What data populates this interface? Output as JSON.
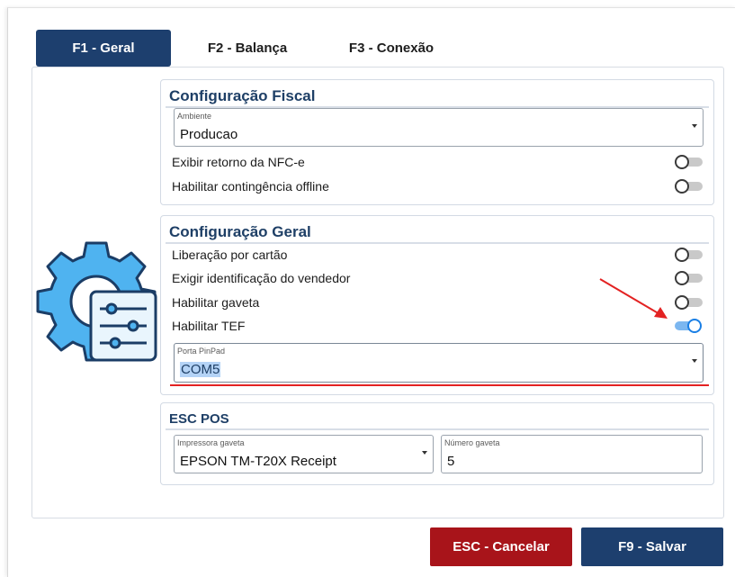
{
  "tabs": [
    {
      "label": "F1 - Geral",
      "active": true
    },
    {
      "label": "F2 - Balança",
      "active": false
    },
    {
      "label": "F3 - Conexão",
      "active": false
    }
  ],
  "fiscal": {
    "title": "Configuração Fiscal",
    "ambiente": {
      "label": "Ambiente",
      "value": "Producao"
    },
    "toggles": [
      {
        "label": "Exibir retorno da NFC-e",
        "on": false
      },
      {
        "label": "Habilitar contingência offline",
        "on": false
      }
    ]
  },
  "geral": {
    "title": "Configuração Geral",
    "toggles": [
      {
        "label": "Liberação por cartão",
        "on": false
      },
      {
        "label": "Exigir identificação do vendedor",
        "on": false
      },
      {
        "label": "Habilitar gaveta",
        "on": false
      },
      {
        "label": "Habilitar TEF",
        "on": true
      }
    ],
    "porta": {
      "label": "Porta PinPad",
      "value": "COM5"
    }
  },
  "escpos": {
    "title": "ESC POS",
    "impressora": {
      "label": "Impressora gaveta",
      "value": "EPSON TM-T20X Receipt"
    },
    "numero": {
      "label": "Número gaveta",
      "value": "5"
    }
  },
  "buttons": {
    "cancel": "ESC - Cancelar",
    "save": "F9 - Salvar"
  },
  "colors": {
    "primary": "#1d3f6e",
    "danger": "#a8141a",
    "toggle_on": "#1a7fe5",
    "annotation": "#e32222"
  },
  "icons": {
    "settings": "gear-sliders-icon",
    "dropdown": "caret-down-icon"
  }
}
